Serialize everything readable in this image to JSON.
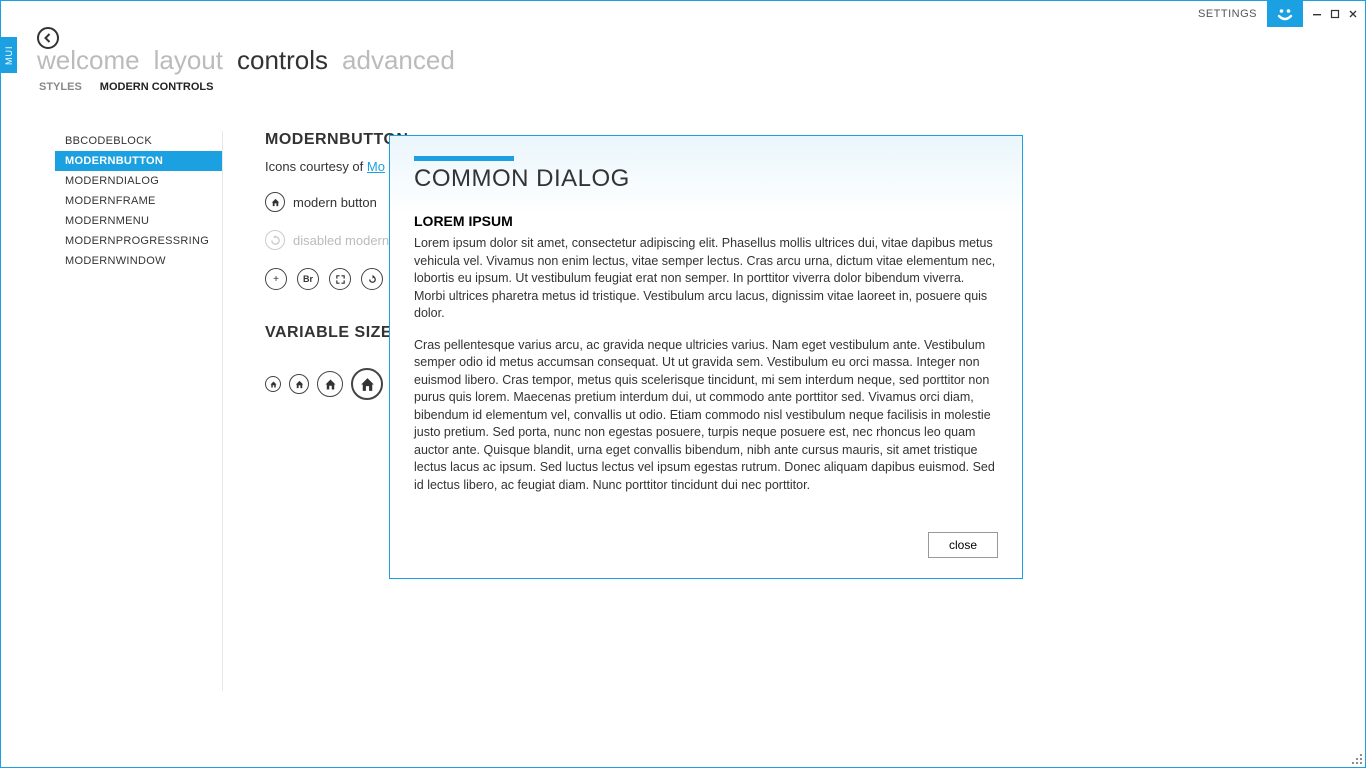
{
  "titlebar": {
    "settings": "SETTINGS",
    "logo_glyph": "☻",
    "min": "—",
    "max": "▢",
    "close": "✕"
  },
  "mui_tab": "MUI",
  "main_tabs": {
    "t0": "welcome",
    "t1": "layout",
    "t2": "controls",
    "t3": "advanced"
  },
  "sub_tabs": {
    "s0": "STYLES",
    "s1": "MODERN CONTROLS"
  },
  "sidebar": {
    "i0": "BBCODEBLOCK",
    "i1": "MODERNBUTTON",
    "i2": "MODERNDIALOG",
    "i3": "MODERNFRAME",
    "i4": "MODERNMENU",
    "i5": "MODERNPROGRESSRING",
    "i6": "MODERNWINDOW"
  },
  "content": {
    "heading": "MODERNBUTTON",
    "subtitle_prefix": "Icons courtesy of ",
    "subtitle_link": "Mo",
    "btn1_label": "modern button",
    "btn2_label": "disabled modern",
    "section_sizes": "VARIABLE SIZES",
    "icons": {
      "plus": "+",
      "br": "Br",
      "expand": "⤢",
      "redo": "↻",
      "check": "✓"
    }
  },
  "dialog": {
    "title": "COMMON DIALOG",
    "section_title": "LOREM IPSUM",
    "p1": "Lorem ipsum dolor sit amet, consectetur adipiscing elit. Phasellus mollis ultrices dui, vitae dapibus metus vehicula vel. Vivamus non enim lectus, vitae semper lectus. Cras arcu urna, dictum vitae elementum nec, lobortis eu ipsum. Ut vestibulum feugiat erat non semper. In porttitor viverra dolor bibendum viverra. Morbi ultrices pharetra metus id tristique. Vestibulum arcu lacus, dignissim vitae laoreet in, posuere quis dolor.",
    "p2": "Cras pellentesque varius arcu, ac gravida neque ultricies varius. Nam eget vestibulum ante. Vestibulum semper odio id metus accumsan consequat. Ut ut gravida sem. Vestibulum eu orci massa. Integer non euismod libero. Cras tempor, metus quis scelerisque tincidunt, mi sem interdum neque, sed porttitor non purus quis lorem. Maecenas pretium interdum dui, ut commodo ante porttitor sed. Vivamus orci diam, bibendum id elementum vel, convallis ut odio. Etiam commodo nisl vestibulum neque facilisis in molestie justo pretium. Sed porta, nunc non egestas posuere, turpis neque posuere est, nec rhoncus leo quam auctor ante. Quisque blandit, urna eget convallis bibendum, nibh ante cursus mauris, sit amet tristique lectus lacus ac ipsum. Sed luctus lectus vel ipsum egestas rutrum. Donec aliquam dapibus euismod. Sed id lectus libero, ac feugiat diam. Nunc porttitor tincidunt dui nec porttitor.",
    "close": "close"
  }
}
